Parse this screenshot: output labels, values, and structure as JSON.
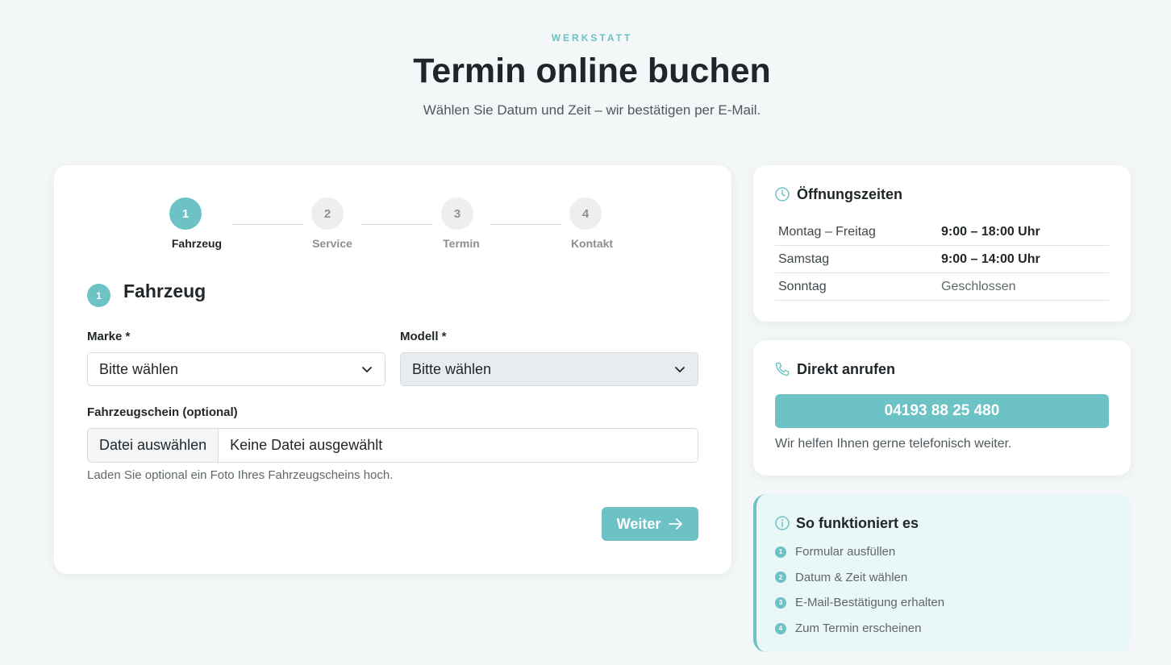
{
  "header": {
    "eyebrow": "WERKSTATT",
    "title": "Termin online buchen",
    "subtitle": "Wählen Sie Datum und Zeit – wir bestätigen per E-Mail."
  },
  "stepper": {
    "steps": [
      {
        "number": "1",
        "label": "Fahrzeug"
      },
      {
        "number": "2",
        "label": "Service"
      },
      {
        "number": "3",
        "label": "Termin"
      },
      {
        "number": "4",
        "label": "Kontakt"
      }
    ]
  },
  "form": {
    "section_number": "1",
    "section_title": "Fahrzeug",
    "brand_label": "Marke *",
    "brand_value": "Bitte wählen",
    "model_label": "Modell *",
    "model_value": "Bitte wählen",
    "file_label": "Fahrzeugschein (optional)",
    "file_button": "Datei auswählen",
    "file_status": "Keine Datei ausgewählt",
    "file_hint": "Laden Sie optional ein Foto Ihres Fahrzeugscheins hoch.",
    "next_label": "Weiter"
  },
  "hours": {
    "title": "Öffnungszeiten",
    "rows": [
      {
        "day": "Montag – Freitag",
        "time": "9:00 – 18:00 Uhr"
      },
      {
        "day": "Samstag",
        "time": "9:00 – 14:00 Uhr"
      },
      {
        "day": "Sonntag",
        "time": "Geschlossen"
      }
    ]
  },
  "call": {
    "title": "Direkt anrufen",
    "phone": "04193 88 25 480",
    "note": "Wir helfen Ihnen gerne telefonisch weiter."
  },
  "how": {
    "title": "So funktioniert es",
    "items": [
      {
        "number": "1",
        "text": "Formular ausfüllen"
      },
      {
        "number": "2",
        "text": "Datum & Zeit wählen"
      },
      {
        "number": "3",
        "text": "E-Mail-Bestätigung erhalten"
      },
      {
        "number": "4",
        "text": "Zum Termin erscheinen"
      }
    ]
  },
  "colors": {
    "accent": "#6cc2c4",
    "background": "#f3f7f7",
    "info_background": "#e9f7f6"
  }
}
